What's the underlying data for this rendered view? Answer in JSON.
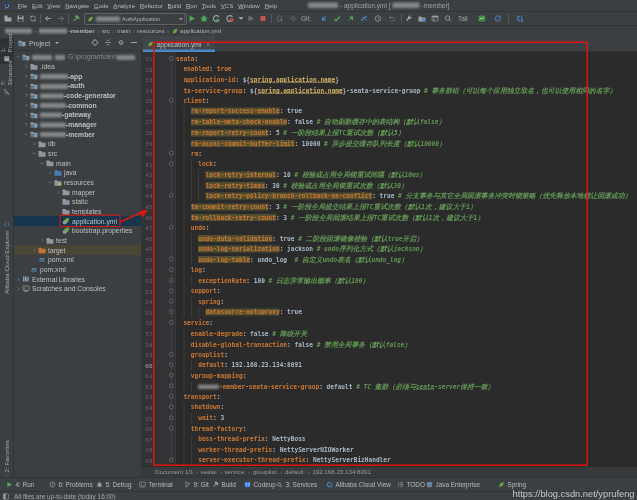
{
  "colors": {
    "window_bg": "#3c3f41",
    "editor_bg": "#2b2b2b",
    "gutter_bg": "#313335",
    "key_orange": "#cc7832",
    "value_gray": "#a9b7c6",
    "comment_green": "#629755",
    "warn_highlight": "#4e4a33",
    "tab_accent_blue": "#4a88c7",
    "annotation_red": "#e01512",
    "selection_blue": "#17364d",
    "target_row": "#4a4534",
    "spring_green": "#6db33f"
  },
  "titlebar": {
    "logo_icon": "idea-logo",
    "menus": [
      "File",
      "Edit",
      "View",
      "Navigate",
      "Code",
      "Analyze",
      "Refactor",
      "Build",
      "Run",
      "Tools",
      "VCS",
      "Window",
      "Help"
    ],
    "title_parts": [
      {
        "r": 60
      },
      {
        "t": " - application.yml ["
      },
      {
        "r": 54
      },
      {
        "t": "-member]"
      }
    ]
  },
  "toolbar": {
    "combo": {
      "icon": "spring-leaf",
      "parts": [
        {
          "r": 48
        },
        {
          "t": "AuthApplication"
        }
      ],
      "caret": "caret-down"
    },
    "git_label": "Git:",
    "tail_label": "Tail",
    "icons": [
      "open-folder",
      "save",
      "sync",
      "back-arrow",
      "forward-arrow",
      "hammer",
      "run-play",
      "debug-bug",
      "coverage",
      "profiler",
      "caret-down",
      "play-dim",
      "stop",
      "attach-dim",
      "settings-dim",
      "update-blue",
      "commit-check",
      "push-green",
      "compare-blue",
      "history-clock",
      "undo-dim",
      "wrench",
      "folder-blue",
      "window-tool",
      "search",
      "monitor-green",
      "ban-blue",
      "cloud-c"
    ]
  },
  "navbar": {
    "crumbs": [
      {
        "parts": [
          {
            "r": 54
          }
        ]
      },
      {
        "parts": [
          {
            "r": 56
          },
          {
            "t": "-member",
            "bold": true
          }
        ]
      },
      {
        "parts": [
          {
            "t": "src"
          }
        ]
      },
      {
        "parts": [
          {
            "t": "main"
          }
        ]
      },
      {
        "parts": [
          {
            "t": "resources"
          }
        ]
      },
      {
        "icon": "spring-leaf",
        "parts": [
          {
            "t": "application.yml"
          }
        ]
      }
    ]
  },
  "stripes": {
    "top": [
      {
        "icon": "project-tool",
        "label": "1: Project",
        "active": true
      },
      {
        "icon": "structure-tool",
        "label": "7: Structure"
      },
      {
        "icon": "braces-blue",
        "label": "Alibaba Cloud Explorer",
        "icon_top": true
      }
    ],
    "bottom": [
      {
        "icon": "star",
        "label": "2: Favorites"
      },
      {
        "icon": "globe",
        "label": "Web"
      }
    ]
  },
  "project_panel": {
    "header": {
      "title": "Project",
      "caret": "caret-down",
      "icons": [
        "locate",
        "collapse-all",
        "gear",
        "minus"
      ]
    },
    "tree": [
      {
        "level": 0,
        "chev": "down",
        "icon": "folder-module",
        "parts": [
          {
            "r": 40
          },
          {
            "sp": 6
          },
          {
            "r": 20
          },
          {
            "sp": 6
          },
          {
            "t": "G:\\program\\dev\\",
            "dim": true
          },
          {
            "r": 36
          }
        ]
      },
      {
        "level": 1,
        "chev": "right",
        "icon": "folder",
        "parts": [
          {
            "t": ".idea"
          }
        ]
      },
      {
        "level": 1,
        "chev": "right",
        "icon": "folder-module",
        "parts": [
          {
            "r": 56
          },
          {
            "t": "-app",
            "bold": true
          }
        ]
      },
      {
        "level": 1,
        "chev": "right",
        "icon": "folder-module",
        "parts": [
          {
            "r": 56
          },
          {
            "t": "-auth",
            "bold": true
          }
        ]
      },
      {
        "level": 1,
        "chev": "right",
        "icon": "folder-module",
        "parts": [
          {
            "r": 48
          },
          {
            "t": "-code-generator",
            "bold": true
          }
        ]
      },
      {
        "level": 1,
        "chev": "right",
        "icon": "folder-module",
        "parts": [
          {
            "r": 52
          },
          {
            "t": "-common",
            "bold": true
          }
        ]
      },
      {
        "level": 1,
        "chev": "right",
        "icon": "folder-module",
        "parts": [
          {
            "r": 44
          },
          {
            "t": "-gateway",
            "bold": true
          }
        ]
      },
      {
        "level": 1,
        "chev": "right",
        "icon": "folder-module",
        "parts": [
          {
            "r": 52
          },
          {
            "t": "-manager",
            "bold": true
          }
        ]
      },
      {
        "level": 1,
        "chev": "down",
        "icon": "folder-module",
        "parts": [
          {
            "r": 52
          },
          {
            "t": "-member",
            "bold": true
          }
        ]
      },
      {
        "level": 2,
        "chev": "right",
        "icon": "folder",
        "parts": [
          {
            "t": "db"
          }
        ]
      },
      {
        "level": 2,
        "chev": "down",
        "icon": "folder",
        "parts": [
          {
            "t": "src"
          }
        ]
      },
      {
        "level": 3,
        "chev": "down",
        "icon": "folder",
        "parts": [
          {
            "t": "main"
          }
        ]
      },
      {
        "level": 4,
        "chev": "right",
        "icon": "folder-java",
        "parts": [
          {
            "t": "java"
          }
        ]
      },
      {
        "level": 4,
        "chev": "down",
        "icon": "folder-resources",
        "parts": [
          {
            "t": "resources"
          }
        ]
      },
      {
        "level": 5,
        "chev": "right",
        "icon": "folder",
        "parts": [
          {
            "t": "mapper"
          }
        ]
      },
      {
        "level": 5,
        "chev": "none",
        "icon": "folder",
        "parts": [
          {
            "t": "static"
          }
        ]
      },
      {
        "level": 5,
        "chev": "none",
        "icon": "folder",
        "parts": [
          {
            "t": "templates"
          }
        ]
      },
      {
        "level": 5,
        "chev": "none",
        "icon": "spring-file",
        "parts": [
          {
            "t": "application.yml"
          }
        ],
        "selected": true,
        "annotated": true
      },
      {
        "level": 5,
        "chev": "none",
        "icon": "spring-file",
        "parts": [
          {
            "t": "bootstrap.properties"
          }
        ]
      },
      {
        "level": 3,
        "chev": "right",
        "icon": "folder-test",
        "parts": [
          {
            "t": "test"
          }
        ]
      },
      {
        "level": 2,
        "chev": "right",
        "icon": "folder-excluded",
        "parts": [
          {
            "t": "target"
          }
        ],
        "target_row": true
      },
      {
        "level": 2,
        "chev": "none",
        "icon": "maven",
        "parts": [
          {
            "t": "pom.xml"
          }
        ]
      },
      {
        "level": 1,
        "chev": "none",
        "icon": "maven",
        "parts": [
          {
            "t": "pom.xml"
          }
        ]
      },
      {
        "level": 0,
        "chev": "right",
        "icon": "libraries",
        "parts": [
          {
            "t": "External Libraries"
          }
        ]
      },
      {
        "level": 0,
        "chev": "right",
        "icon": "scratches",
        "parts": [
          {
            "t": "Scratches and Consoles"
          }
        ]
      }
    ]
  },
  "editor": {
    "tab": {
      "icon": "spring-leaf",
      "label": "application.yml",
      "close": "×"
    },
    "current_line": 60,
    "lines": [
      {
        "n": 31,
        "c": 0,
        "k": "seata"
      },
      {
        "n": 32,
        "c": 2,
        "k": "enabled",
        "v": "true",
        "vcls": "vo"
      },
      {
        "n": 33,
        "c": 2,
        "k": "application-id",
        "vparts": [
          {
            "t": "${",
            "cls": "v"
          },
          {
            "t": "spring.application.name",
            "cls": "ref"
          },
          {
            "t": "}",
            "cls": "v"
          }
        ]
      },
      {
        "n": 34,
        "c": 2,
        "k": "tx-service-group",
        "vparts": [
          {
            "t": "${",
            "cls": "v"
          },
          {
            "t": "spring.application.name",
            "cls": "ref"
          },
          {
            "t": "}-seata-service-gruop",
            "cls": "v"
          }
        ],
        "com": "# 事务群组（可以每个应用独立取名，也可以使用相同的名字）"
      },
      {
        "n": 35,
        "c": 2,
        "k": "client"
      },
      {
        "n": 36,
        "c": 4,
        "k": "rm-report-success-enable",
        "warn": true,
        "v": "true"
      },
      {
        "n": 37,
        "c": 4,
        "k": "rm-table-meta-check-enable",
        "warn": true,
        "v": "false",
        "com": "# 自动刷新缓存中的表结构（默认false）"
      },
      {
        "n": 38,
        "c": 4,
        "k": "rm-report-retry-count",
        "warn": true,
        "v": "5",
        "com": "# 一阶段结果上报TC重试次数（默认5）"
      },
      {
        "n": 39,
        "c": 4,
        "k": "rm-async-commit-buffer-limit",
        "warn": true,
        "v": "10000",
        "com": "# 异步提交缓存队列长度（默认10000）"
      },
      {
        "n": 40,
        "c": 4,
        "k": "rm"
      },
      {
        "n": 41,
        "c": 6,
        "k": "lock"
      },
      {
        "n": 42,
        "c": 8,
        "k": "lock-retry-internal",
        "warn": true,
        "v": "10",
        "com": "# 校验或占用全局锁重试间隔（默认10ms）"
      },
      {
        "n": 43,
        "c": 8,
        "k": "lock-retry-times",
        "warn": true,
        "v": "30",
        "com": "# 校验或占用全局锁重试次数（默认30）"
      },
      {
        "n": 44,
        "c": 8,
        "k": "lock-retry-policy-branch-rollback-on-conflict",
        "warn": true,
        "v": "true",
        "com": "# 分支事务与其它全局回滚事务冲突时锁策略（优先释放本地锁让回滚成功）"
      },
      {
        "n": 45,
        "c": 4,
        "k": "tm-commit-retry-count",
        "warn": true,
        "v": "3",
        "com": "# 一阶段全局提交结果上报TC重试次数（默认1次，建议大于1）"
      },
      {
        "n": 46,
        "c": 4,
        "k": "tm-rollback-retry-count",
        "warn": true,
        "v": "3",
        "com": "# 一阶段全局回滚结果上报TC重试次数（默认1次，建议大于1）"
      },
      {
        "n": 47,
        "c": 4,
        "k": "undo"
      },
      {
        "n": 48,
        "c": 6,
        "k": "undo-data-validation",
        "warn": true,
        "v": "true",
        "com": "# 二阶段回滚镜像校验（默认true开启）"
      },
      {
        "n": 49,
        "c": 6,
        "k": "undo-log-serialization",
        "warn": true,
        "v": "jackson",
        "com": "# undo序列化方式（默认jackson）"
      },
      {
        "n": 50,
        "c": 6,
        "k": "undo-log-table",
        "warn": true,
        "v": "undo_log",
        "com": "# 自定义undo表名（默认undo_log）",
        "comgap": 2
      },
      {
        "n": 51,
        "c": 4,
        "k": "log"
      },
      {
        "n": 52,
        "c": 6,
        "k": "exceptionRate",
        "v": "100",
        "com": "# 日志异常输出概率（默认100）"
      },
      {
        "n": 53,
        "c": 4,
        "k": "support"
      },
      {
        "n": 54,
        "c": 6,
        "k": "spring"
      },
      {
        "n": 55,
        "c": 8,
        "k": "datasource-autoproxy",
        "warn": true,
        "v": "true"
      },
      {
        "n": 56,
        "c": 2,
        "k": "service"
      },
      {
        "n": 57,
        "c": 4,
        "k": "enable-degrade",
        "v": "false",
        "com": "# 降级开关"
      },
      {
        "n": 58,
        "c": 4,
        "k": "disable-global-transaction",
        "v": "false",
        "com": "# 禁用全局事务（默认false）"
      },
      {
        "n": 59,
        "c": 4,
        "k": "grouplist"
      },
      {
        "n": 60,
        "c": 6,
        "k": "default",
        "v": "192.168.23.134:8091"
      },
      {
        "n": 61,
        "c": 4,
        "k": "vgroup-mapping"
      },
      {
        "n": 62,
        "c": 6,
        "kparts": [
          {
            "r": 42
          },
          {
            "t": "-member-seata-service-gruop"
          }
        ],
        "v": "default",
        "comparts": [
          {
            "t": "# TC 集群（必须与"
          },
          {
            "t": "seata",
            "u": true
          },
          {
            "t": "-server保持一致）"
          }
        ]
      },
      {
        "n": 63,
        "c": 2,
        "k": "transport"
      },
      {
        "n": 64,
        "c": 4,
        "k": "shutdown"
      },
      {
        "n": 65,
        "c": 6,
        "k": "wait",
        "v": "3"
      },
      {
        "n": 66,
        "c": 4,
        "k": "thread-factory"
      },
      {
        "n": 67,
        "c": 6,
        "k": "boss-thread-prefix",
        "v": "NettyBoss"
      },
      {
        "n": 68,
        "c": 6,
        "k": "worker-thread-prefix",
        "v": "NettyServerNIOWorker"
      },
      {
        "n": 69,
        "c": 6,
        "k": "server-executor-thread-prefix",
        "v": "NettyServerBizHandler"
      }
    ],
    "folds": {
      "starts": [
        31,
        35,
        40,
        41,
        47,
        51,
        53,
        54,
        56,
        59,
        61,
        63,
        64,
        66
      ],
      "ends": [
        44,
        50,
        52,
        55,
        60,
        62,
        65,
        69
      ]
    },
    "crumbs": [
      "Document 1/1",
      "seata:",
      "service:",
      "grouplist:",
      "default:",
      "192.168.23.134:8091"
    ]
  },
  "bottombar": {
    "items": [
      {
        "icon": "run-play",
        "label": "4: Run"
      },
      {
        "icon": "problems",
        "label": "6: Problems"
      },
      {
        "icon": "debug-gray",
        "label": "5: Debug"
      },
      {
        "icon": "terminal",
        "label": "Terminal"
      },
      {
        "icon": "git-branch",
        "label": "9: Git"
      },
      {
        "icon": "hammer-gray",
        "label": "Build"
      },
      {
        "icon": "codeup-blue",
        "label": "Codeup"
      },
      {
        "icon": "services",
        "label": "3: Services"
      },
      {
        "icon": "cloud-c",
        "label": "Alibaba Cloud View"
      },
      {
        "icon": "todo-list",
        "label": "TODO"
      },
      {
        "icon": "java-ee",
        "label": "Java Enterprise"
      },
      {
        "icon": "spring-leaf",
        "label": "Spring"
      }
    ]
  },
  "statusbar": {
    "left_icon": "toggle-tool",
    "left_text": "All files are up-to-date (today 16:00)",
    "watermark": "https://blog.csdn.net/yprufeng"
  }
}
